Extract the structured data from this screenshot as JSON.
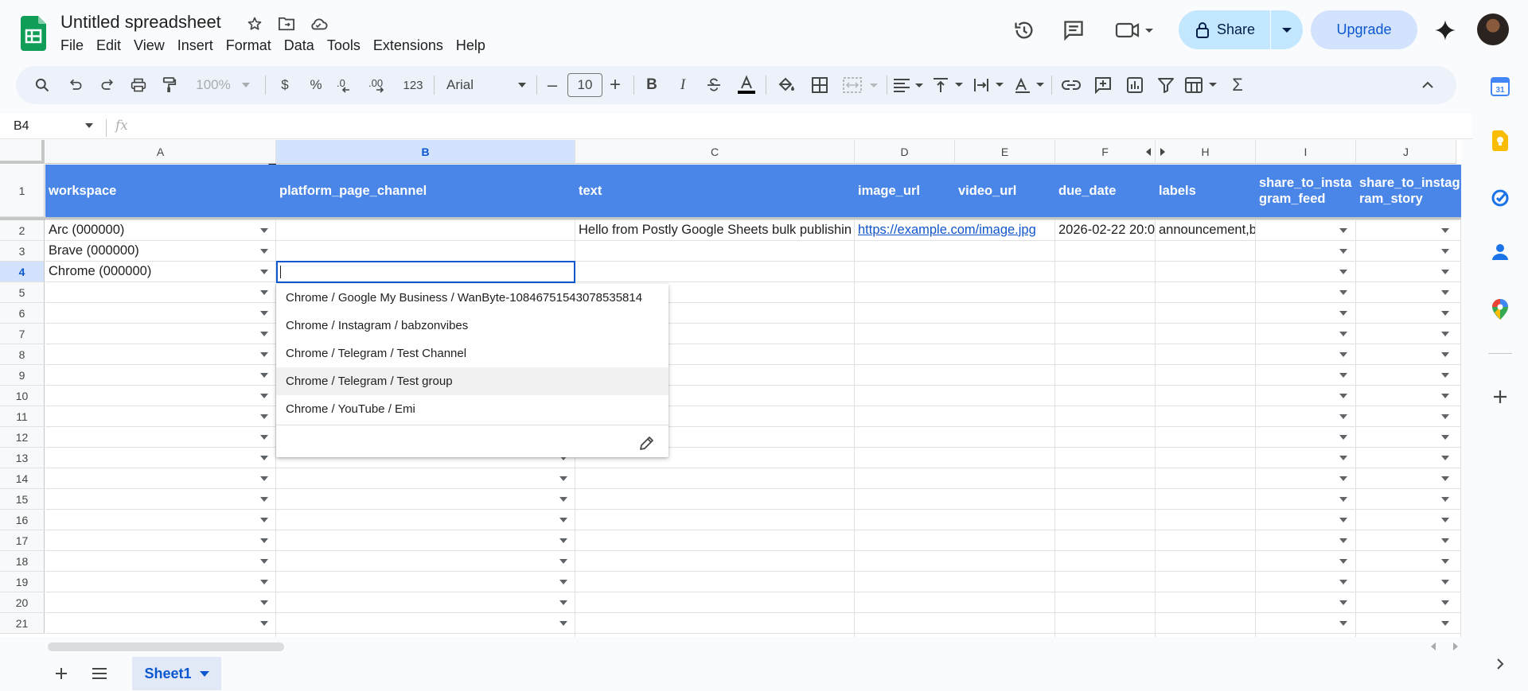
{
  "app": {
    "title": "Untitled spreadsheet",
    "menu": [
      "File",
      "Edit",
      "View",
      "Insert",
      "Format",
      "Data",
      "Tools",
      "Extensions",
      "Help"
    ],
    "share_label": "Share",
    "upgrade_label": "Upgrade"
  },
  "toolbar": {
    "zoom": "100%",
    "currency": "$",
    "percent": "%",
    "dec_decrease": ".0←",
    "dec_increase": ".00",
    "number_format": "123",
    "font": "Arial",
    "font_size": "10",
    "minus": "–",
    "plus": "+"
  },
  "formula_bar": {
    "name_box": "B4",
    "fx": "fx"
  },
  "grid": {
    "columns": [
      "A",
      "B",
      "C",
      "D",
      "E",
      "F",
      "H",
      "I",
      "J"
    ],
    "selected_column": "B",
    "rows": [
      "1",
      "2",
      "3",
      "4",
      "5",
      "6",
      "7",
      "8",
      "9",
      "10",
      "11",
      "12",
      "13",
      "14",
      "15",
      "16",
      "17",
      "18",
      "19",
      "20",
      "21"
    ],
    "selected_row": "4",
    "header_row": [
      "workspace",
      "platform_page_channel",
      "text",
      "image_url",
      "video_url",
      "due_date",
      "labels",
      "share_to_instagram_feed",
      "share_to_instagram_story"
    ],
    "row2": {
      "workspace": "Arc (000000)",
      "text": "Hello from Postly Google Sheets bulk publishin",
      "image_url": "https://example.com/image.jpg",
      "due_date": "2026-02-22 20:0",
      "labels": "announcement,b"
    },
    "row3": {
      "workspace": "Brave (000000)"
    },
    "row4": {
      "workspace": "Chrome (000000)"
    }
  },
  "dropdown": {
    "options": [
      "Chrome / Google My Business / WanByte-10846751543078535814",
      "Chrome / Instagram / babzonvibes",
      "Chrome / Telegram / Test Channel",
      "Chrome / Telegram / Test group",
      "Chrome / YouTube / Emi"
    ],
    "hovered_index": 3
  },
  "sheets": {
    "active": "Sheet1"
  },
  "colors": {
    "header_fill": "#4a86e8",
    "selection": "#0b57d0",
    "share_button": "#c2e7ff"
  }
}
